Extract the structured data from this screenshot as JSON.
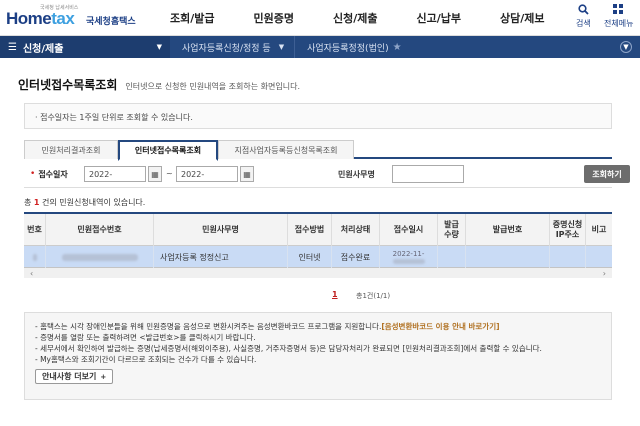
{
  "header": {
    "logo_sub": "국세청 납세서비스",
    "logo_home": "Home",
    "logo_tax": "tax",
    "logo_kr": "국세청홈택스",
    "menu": [
      "조회/발급",
      "민원증명",
      "신청/제출",
      "신고/납부",
      "상담/제보"
    ],
    "search_label": "검색",
    "allmenu_label": "전체메뉴"
  },
  "breadcrumb": {
    "first": "신청/제출",
    "second": "사업자등록신청/정정 등",
    "third": "사업자등록정정(법인)"
  },
  "page": {
    "title": "인터넷접수목록조회",
    "description": "인터넷으로 신청한 민원내역을 조회하는 화면입니다.",
    "notice": "· 접수일자는 1주일 단위로 조회할 수 있습니다."
  },
  "tabs": [
    {
      "label": "민원처리결과조회",
      "active": false
    },
    {
      "label": "인터넷접수목록조회",
      "active": true
    },
    {
      "label": "지점사업자등록등신청목록조회",
      "active": false
    }
  ],
  "search": {
    "date_label": "접수일자",
    "start_date": "2022-",
    "end_date": "2022-",
    "tilde": "~",
    "petition_label": "민원사무명",
    "petition_value": "",
    "button": "조회하기"
  },
  "results": {
    "prefix": "총 ",
    "count": "1",
    "suffix": " 건의 민원신청내역이 있습니다."
  },
  "table": {
    "columns": [
      "번호",
      "민원접수번호",
      "민원사무명",
      "접수방법",
      "처리상태",
      "접수일시",
      "발급\n수량",
      "발급번호",
      "증명신청\nIP주소",
      "비고"
    ],
    "rows": [
      {
        "no": "",
        "receipt_no": "",
        "petition": "사업자등록 정정신고",
        "method": "인터넷",
        "status": "접수완료",
        "datetime": "2022-11-",
        "qty": "",
        "issue_no": "",
        "ip": "",
        "note": ""
      }
    ]
  },
  "pagination": {
    "current": "1",
    "info": "총1건(1/1)"
  },
  "info": {
    "lines": [
      "- 홈택스는 시각 장애인분들을 위해 민원증명을 음성으로 변환시켜주는 음성변환바코드 프로그램을 지원합니다.",
      "[음성변환바코드 이용 안내 바로가기]",
      "- 증명서를 열람 또는 출력하려면 <발급번호>를 클릭하시기 바랍니다.",
      "- 세무서에서 확인하여 발급하는 증명(납세증명서(해외이주용), 사실증명, 거주자증명서 등)은 담당자처리가 완료되면 [민원처리결과조회]에서 출력할 수 있습니다.",
      "- My홈택스와 조회기간이 다르므로 조회되는 건수가 다를 수 있습니다."
    ],
    "more_button": "안내사항 더보기",
    "more_icon": "+"
  },
  "colors": {
    "nav": "#24487f",
    "row_highlight": "#c9dbf5",
    "accent_red": "#d02020"
  }
}
